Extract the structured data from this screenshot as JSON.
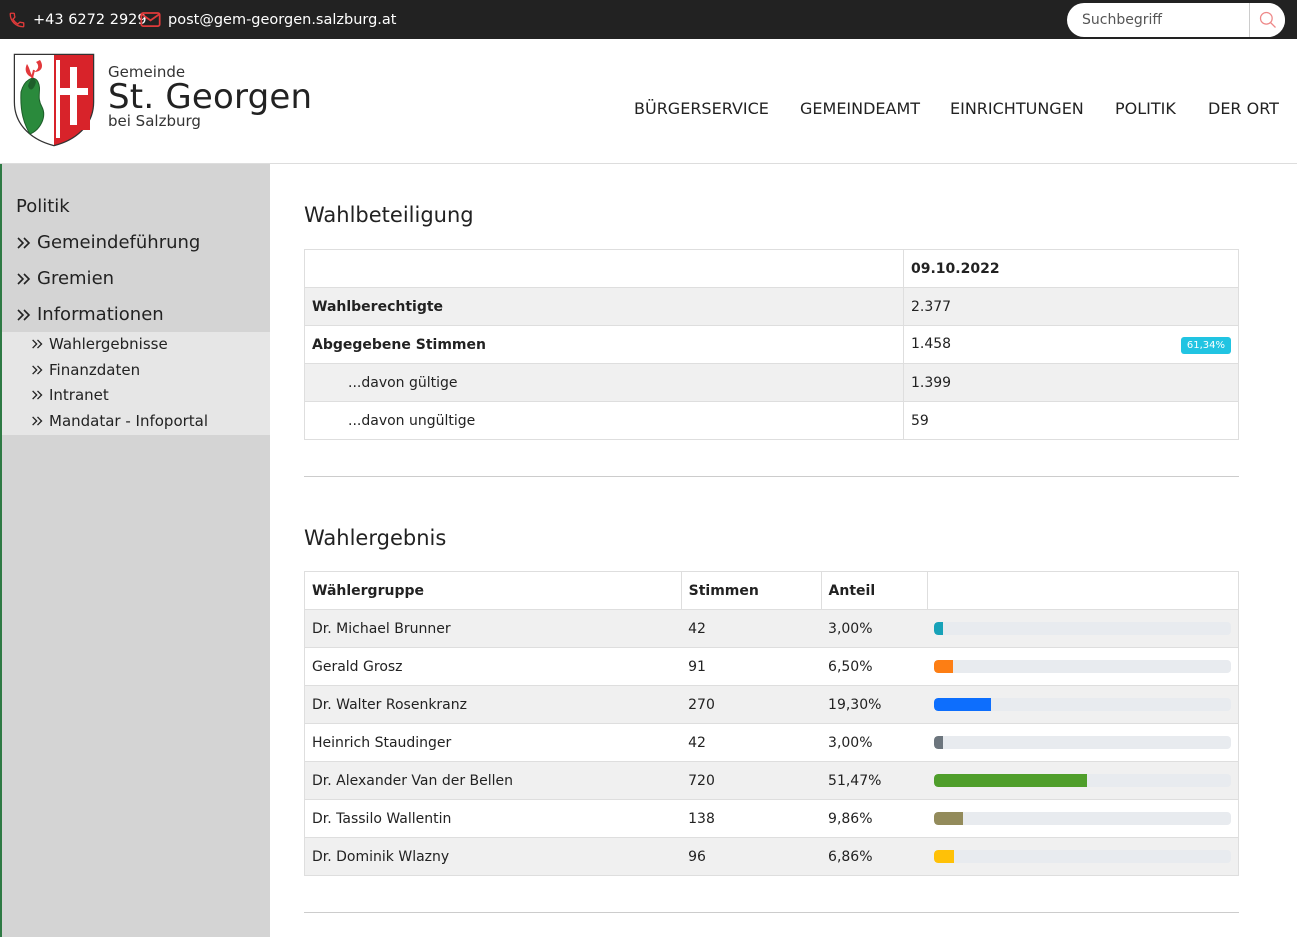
{
  "topbar": {
    "phone": "+43 6272 2929",
    "email": "post@gem-georgen.salzburg.at",
    "search_placeholder": "Suchbegriff",
    "icons": [
      "phone-icon",
      "mail-icon",
      "search-icon"
    ]
  },
  "brand": {
    "top": "Gemeinde",
    "main": "St. Georgen",
    "bottom": "bei Salzburg"
  },
  "nav": [
    "BÜRGERSERVICE",
    "GEMEINDEAMT",
    "EINRICHTUNGEN",
    "POLITIK",
    "DER ORT"
  ],
  "sidebar": {
    "title": "Politik",
    "items": [
      "Gemeindeführung",
      "Gremien",
      "Informationen"
    ],
    "subitems": [
      "Wahlergebnisse",
      "Finanzdaten",
      "Intranet",
      "Mandatar - Infoportal"
    ]
  },
  "turnout": {
    "heading": "Wahlbeteiligung",
    "date": "09.10.2022",
    "rows": [
      {
        "label": "Wahlberechtigte",
        "value": "2.377"
      },
      {
        "label": "Abgegebene Stimmen",
        "value": "1.458",
        "badge": "61,34%"
      },
      {
        "label": "...davon gültige",
        "value": "1.399"
      },
      {
        "label": "...davon ungültige",
        "value": "59"
      }
    ]
  },
  "result": {
    "heading": "Wahlergebnis",
    "headers": [
      "Wählergruppe",
      "Stimmen",
      "Anteil"
    ],
    "rows": [
      {
        "name": "Dr. Michael Brunner",
        "votes": "42",
        "share": "3,00%",
        "pct": 3.0,
        "color": "#17a2b8"
      },
      {
        "name": "Gerald Grosz",
        "votes": "91",
        "share": "6,50%",
        "pct": 6.5,
        "color": "#fd7e14"
      },
      {
        "name": "Dr. Walter Rosenkranz",
        "votes": "270",
        "share": "19,30%",
        "pct": 19.3,
        "color": "#0d6efd"
      },
      {
        "name": "Heinrich Staudinger",
        "votes": "42",
        "share": "3,00%",
        "pct": 3.0,
        "color": "#6c757d"
      },
      {
        "name": "Dr. Alexander Van der Bellen",
        "votes": "720",
        "share": "51,47%",
        "pct": 51.47,
        "color": "#4f9e2b"
      },
      {
        "name": "Dr. Tassilo Wallentin",
        "votes": "138",
        "share": "9,86%",
        "pct": 9.86,
        "color": "#938b5b"
      },
      {
        "name": "Dr. Dominik Wlazny",
        "votes": "96",
        "share": "6,86%",
        "pct": 6.86,
        "color": "#ffc107"
      }
    ]
  }
}
